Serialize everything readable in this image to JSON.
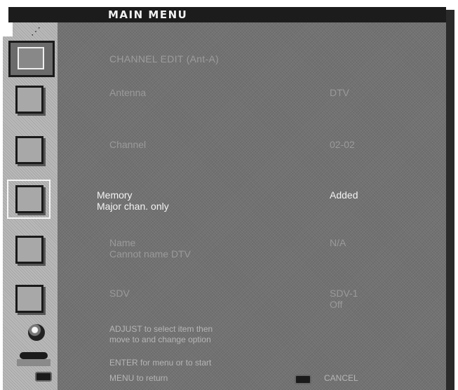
{
  "menu": {
    "title": "MAIN MENU",
    "section_title": "CHANNEL EDIT (Ant-A)"
  },
  "rows": [
    {
      "label": "Antenna",
      "sublabel": "",
      "value": "DTV",
      "value2": "",
      "active": false
    },
    {
      "label": "Channel",
      "sublabel": "",
      "value": "02-02",
      "value2": "",
      "active": false
    },
    {
      "label": "Memory",
      "sublabel": "Major chan. only",
      "value": "Added",
      "value2": "",
      "active": true
    },
    {
      "label": "Name",
      "sublabel": "Cannot name DTV",
      "value": "N/A",
      "value2": "",
      "active": false
    },
    {
      "label": "SDV",
      "sublabel": "",
      "value": "SDV-1",
      "value2": "Off",
      "active": false
    }
  ],
  "help": {
    "adjust_line1": "ADJUST to select item then",
    "adjust_line2": "move to and change option",
    "enter_line": "ENTER for menu or to start",
    "menu_line": "MENU to return",
    "cancel_label": "CANCEL"
  },
  "icons": {
    "selected": "menu-selected-icon",
    "items": [
      "antenna-icon",
      "channel-icon",
      "memory-icon",
      "name-icon",
      "sdv-icon"
    ],
    "knob": "adjust-knob-icon",
    "enter": "enter-button-icon",
    "menu": "menu-button-icon",
    "cancel": "cancel-button-icon"
  },
  "colors": {
    "panel": "#727272",
    "left_column": "#b9b9b9",
    "title_bar": "#1c1c1c",
    "highlight_text": "#f4f4f4",
    "dim_text": "#9a9a9a"
  }
}
